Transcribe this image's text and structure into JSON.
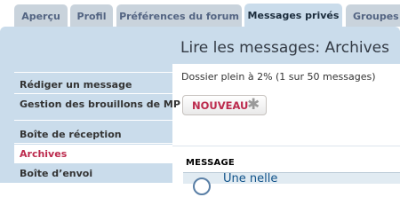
{
  "tabs": [
    {
      "label": "Aperçu"
    },
    {
      "label": "Profil"
    },
    {
      "label": "Préférences du forum"
    },
    {
      "label": "Messages privés"
    },
    {
      "label": "Groupes d"
    }
  ],
  "main": {
    "title": "Lire les messages: Archives",
    "quota": "Dossier plein à 2% (1 sur 50 messages)",
    "new_button": "NOUVEAU",
    "column_header": "MESSAGE",
    "first_message_title": "Une nelle"
  },
  "sidebar": {
    "compose": "Rédiger un message",
    "drafts": "Gestion des brouillons de MP",
    "inbox": "Boîte de réception",
    "archives": "Archives",
    "outbox": "Boîte d’envoi"
  }
}
